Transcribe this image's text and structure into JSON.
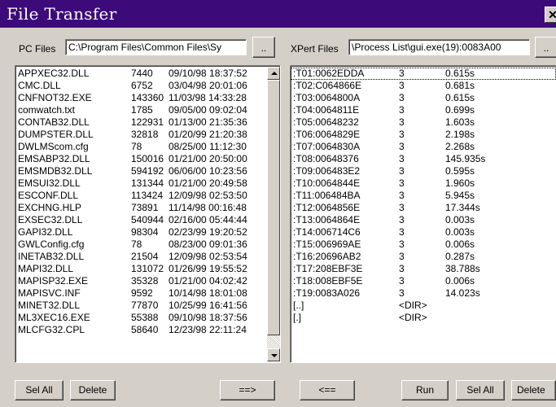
{
  "window": {
    "title": "File Transfer",
    "close_glyph": "✕"
  },
  "pc": {
    "label": "PC Files",
    "path": "C:\\Program Files\\Common Files\\Sy",
    "browse_label": "..",
    "files": [
      {
        "name": "APPXEC32.DLL",
        "size": "7440",
        "date": "09/10/98 18:37:52"
      },
      {
        "name": "CMC.DLL",
        "size": "6752",
        "date": "03/04/98 20:01:06"
      },
      {
        "name": "CNFNOT32.EXE",
        "size": "143360",
        "date": "11/03/98 14:33:28"
      },
      {
        "name": "comwatch.txt",
        "size": "1785",
        "date": "09/05/00 09:02:04"
      },
      {
        "name": "CONTAB32.DLL",
        "size": "122931",
        "date": "01/13/00 21:35:36"
      },
      {
        "name": "DUMPSTER.DLL",
        "size": "32818",
        "date": "01/20/99 21:20:38"
      },
      {
        "name": "DWLMScom.cfg",
        "size": "78",
        "date": "08/25/00 11:12:30"
      },
      {
        "name": "EMSABP32.DLL",
        "size": "150016",
        "date": "01/21/00 20:50:00"
      },
      {
        "name": "EMSMDB32.DLL",
        "size": "594192",
        "date": "06/06/00 10:23:56"
      },
      {
        "name": "EMSUI32.DLL",
        "size": "131344",
        "date": "01/21/00 20:49:58"
      },
      {
        "name": "ESCONF.DLL",
        "size": "113424",
        "date": "12/09/98 02:53:50"
      },
      {
        "name": "EXCHNG.HLP",
        "size": "73891",
        "date": "11/14/98 00:16:48"
      },
      {
        "name": "EXSEC32.DLL",
        "size": "540944",
        "date": "02/16/00 05:44:44"
      },
      {
        "name": "GAPI32.DLL",
        "size": "98304",
        "date": "02/23/99 19:20:52"
      },
      {
        "name": "GWLConfig.cfg",
        "size": "78",
        "date": "08/23/00 09:01:36"
      },
      {
        "name": "INETAB32.DLL",
        "size": "21504",
        "date": "12/09/98 02:53:54"
      },
      {
        "name": "MAPI32.DLL",
        "size": "131072",
        "date": "01/26/99 19:55:52"
      },
      {
        "name": "MAPISP32.EXE",
        "size": "35328",
        "date": "01/21/00 04:02:42"
      },
      {
        "name": "MAPISVC.INF",
        "size": "9592",
        "date": "10/14/98 18:01:08"
      },
      {
        "name": "MINET32.DLL",
        "size": "77870",
        "date": "10/25/99 16:41:56"
      },
      {
        "name": "ML3XEC16.EXE",
        "size": "55388",
        "date": "09/10/98 18:37:56"
      },
      {
        "name": "MLCFG32.CPL",
        "size": "58640",
        "date": "12/23/98 22:11:24"
      }
    ]
  },
  "xpert": {
    "label": "XPert Files",
    "path": "\\Process List\\gui.exe(19):0083A00",
    "browse_label": "..",
    "files": [
      {
        "name": ":T01:0062EDDA",
        "count": "3",
        "time": "0.615s"
      },
      {
        "name": ":T02:C064866E",
        "count": "3",
        "time": "0.681s"
      },
      {
        "name": ":T03:0064800A",
        "count": "3",
        "time": "0.615s"
      },
      {
        "name": ":T04:0064811E",
        "count": "3",
        "time": "0.699s"
      },
      {
        "name": ":T05:00648232",
        "count": "3",
        "time": "1.603s"
      },
      {
        "name": ":T06:0064829E",
        "count": "3",
        "time": "2.198s"
      },
      {
        "name": ":T07:0064830A",
        "count": "3",
        "time": "2.268s"
      },
      {
        "name": ":T08:00648376",
        "count": "3",
        "time": "145.935s"
      },
      {
        "name": ":T09:006483E2",
        "count": "3",
        "time": "0.595s"
      },
      {
        "name": ":T10:0064844E",
        "count": "3",
        "time": "1.960s"
      },
      {
        "name": ":T11:006484BA",
        "count": "3",
        "time": "5.945s"
      },
      {
        "name": ":T12:0064856E",
        "count": "3",
        "time": "17.344s"
      },
      {
        "name": ":T13:0064864E",
        "count": "3",
        "time": "0.003s"
      },
      {
        "name": ":T14:006714C6",
        "count": "3",
        "time": "0.003s"
      },
      {
        "name": ":T15:006969AE",
        "count": "3",
        "time": "0.006s"
      },
      {
        "name": ":T16:20696AB2",
        "count": "3",
        "time": "0.287s"
      },
      {
        "name": ":T17:208EBF3E",
        "count": "3",
        "time": "38.788s"
      },
      {
        "name": ":T18:008EBF5E",
        "count": "3",
        "time": "0.006s"
      },
      {
        "name": ":T19:0083A026",
        "count": "3",
        "time": "14.023s"
      },
      {
        "name": "[..]",
        "count": "<DIR>",
        "time": ""
      },
      {
        "name": "[.]",
        "count": "<DIR>",
        "time": ""
      }
    ]
  },
  "buttons": {
    "pc_sel_all": "Sel All",
    "pc_delete": "Delete",
    "copy_to_xpert": "==>",
    "copy_to_pc": "<==",
    "run": "Run",
    "xpert_sel_all": "Sel All",
    "xpert_delete": "Delete"
  }
}
